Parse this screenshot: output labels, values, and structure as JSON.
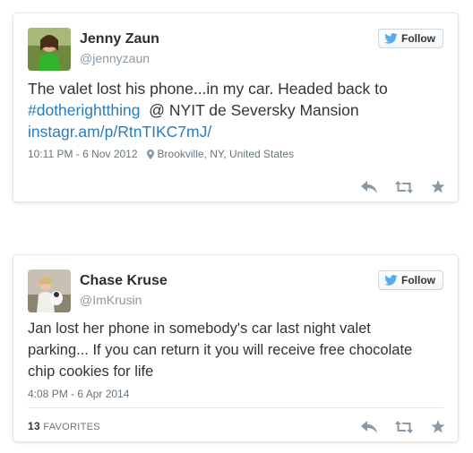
{
  "tweets": [
    {
      "name": "Jenny Zaun",
      "handle": "@jennyzaun",
      "follow_label": "Follow",
      "text_plain1": "The valet lost his phone...in my car. Headed back to",
      "hashtag": "#dotherightthing",
      "text_plain2": "@ NYIT de Seversky Mansion",
      "link": "instagr.am/p/RtnTIKC7mJ/",
      "timestamp": "10:11 PM - 6 Nov 2012",
      "location": "Brookville, NY, United States"
    },
    {
      "name": "Chase Kruse",
      "handle": "@ImKrusin",
      "follow_label": "Follow",
      "text_line1": "Jan lost her phone in somebody's car last night valet",
      "text_line2": "parking... If you can return it you will receive free chocolate",
      "text_line3": "chip cookies for life",
      "timestamp": "4:08 PM - 6 Apr 2014",
      "favorites_count": "13",
      "favorites_label": "FAVORITES"
    }
  ],
  "icons": {
    "reply": "reply-icon",
    "retweet": "retweet-icon",
    "favorite": "star-icon",
    "bird": "twitter-bird-icon",
    "location": "location-pin-icon"
  },
  "colors": {
    "link": "#2b7bb9",
    "muted": "#8899a6",
    "twitter_blue": "#55acee"
  }
}
